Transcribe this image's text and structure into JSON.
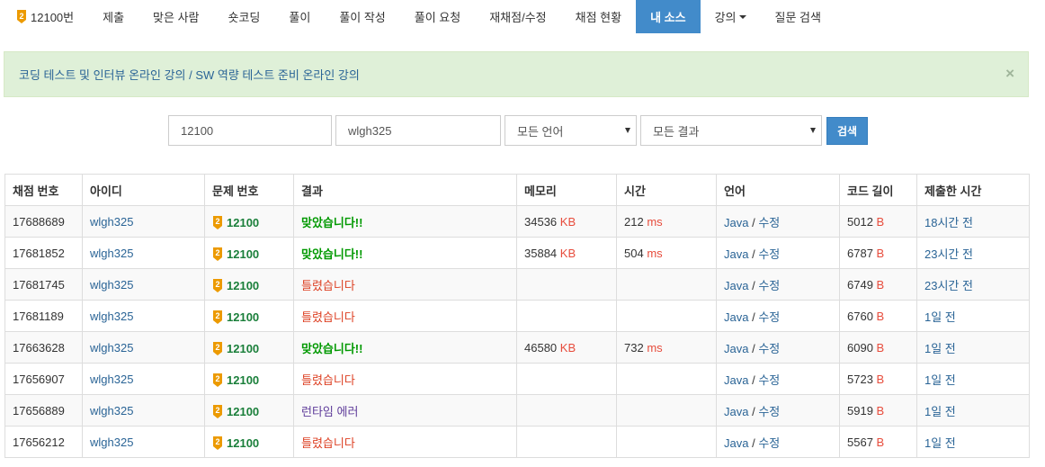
{
  "nav": {
    "problem_tier": "2",
    "problem_label": "12100번",
    "items": [
      "제출",
      "맞은 사람",
      "숏코딩",
      "풀이",
      "풀이 작성",
      "풀이 요청",
      "재채점/수정",
      "채점 현황"
    ],
    "active": "내 소스",
    "lecture": "강의",
    "qa": "질문 검색"
  },
  "alert": {
    "text": "코딩 테스트 및 인터뷰 온라인 강의 / SW 역량 테스트 준비 온라인 강의",
    "close": "×"
  },
  "search": {
    "problem_id": "12100",
    "user_id": "wlgh325",
    "language": "모든 언어",
    "result": "모든 결과",
    "button": "검색"
  },
  "table": {
    "headers": [
      "채점 번호",
      "아이디",
      "문제 번호",
      "결과",
      "메모리",
      "시간",
      "언어",
      "코드 길이",
      "제출한 시간"
    ],
    "rows": [
      {
        "id": "17688689",
        "user": "wlgh325",
        "tier": "2",
        "problem": "12100",
        "result": "맞았습니다!!",
        "status": "ac",
        "memory": "34536",
        "memory_unit": "KB",
        "time": "212",
        "time_unit": "ms",
        "lang": "Java",
        "sep": " / ",
        "edit": "수정",
        "len": "5012",
        "len_unit": "B",
        "submitted": "18시간 전"
      },
      {
        "id": "17681852",
        "user": "wlgh325",
        "tier": "2",
        "problem": "12100",
        "result": "맞았습니다!!",
        "status": "ac",
        "memory": "35884",
        "memory_unit": "KB",
        "time": "504",
        "time_unit": "ms",
        "lang": "Java",
        "sep": " / ",
        "edit": "수정",
        "len": "6787",
        "len_unit": "B",
        "submitted": "23시간 전"
      },
      {
        "id": "17681745",
        "user": "wlgh325",
        "tier": "2",
        "problem": "12100",
        "result": "틀렸습니다",
        "status": "wa",
        "memory": "",
        "memory_unit": "",
        "time": "",
        "time_unit": "",
        "lang": "Java",
        "sep": " / ",
        "edit": "수정",
        "len": "6749",
        "len_unit": "B",
        "submitted": "23시간 전"
      },
      {
        "id": "17681189",
        "user": "wlgh325",
        "tier": "2",
        "problem": "12100",
        "result": "틀렸습니다",
        "status": "wa",
        "memory": "",
        "memory_unit": "",
        "time": "",
        "time_unit": "",
        "lang": "Java",
        "sep": " / ",
        "edit": "수정",
        "len": "6760",
        "len_unit": "B",
        "submitted": "1일 전"
      },
      {
        "id": "17663628",
        "user": "wlgh325",
        "tier": "2",
        "problem": "12100",
        "result": "맞았습니다!!",
        "status": "ac",
        "memory": "46580",
        "memory_unit": "KB",
        "time": "732",
        "time_unit": "ms",
        "lang": "Java",
        "sep": " / ",
        "edit": "수정",
        "len": "6090",
        "len_unit": "B",
        "submitted": "1일 전"
      },
      {
        "id": "17656907",
        "user": "wlgh325",
        "tier": "2",
        "problem": "12100",
        "result": "틀렸습니다",
        "status": "wa",
        "memory": "",
        "memory_unit": "",
        "time": "",
        "time_unit": "",
        "lang": "Java",
        "sep": " / ",
        "edit": "수정",
        "len": "5723",
        "len_unit": "B",
        "submitted": "1일 전"
      },
      {
        "id": "17656889",
        "user": "wlgh325",
        "tier": "2",
        "problem": "12100",
        "result": "런타임 에러",
        "status": "rte",
        "memory": "",
        "memory_unit": "",
        "time": "",
        "time_unit": "",
        "lang": "Java",
        "sep": " / ",
        "edit": "수정",
        "len": "5919",
        "len_unit": "B",
        "submitted": "1일 전"
      },
      {
        "id": "17656212",
        "user": "wlgh325",
        "tier": "2",
        "problem": "12100",
        "result": "틀렸습니다",
        "status": "wa",
        "memory": "",
        "memory_unit": "",
        "time": "",
        "time_unit": "",
        "lang": "Java",
        "sep": " / ",
        "edit": "수정",
        "len": "5567",
        "len_unit": "B",
        "submitted": "1일 전"
      }
    ]
  },
  "colors": {
    "accent": "#428bca",
    "link": "#2a6496",
    "accepted": "#009900",
    "wrong": "#dd4124",
    "runtime_error": "#5d3a99",
    "tier_gold": "#ec9a00",
    "alert_bg": "#dff0d8"
  }
}
